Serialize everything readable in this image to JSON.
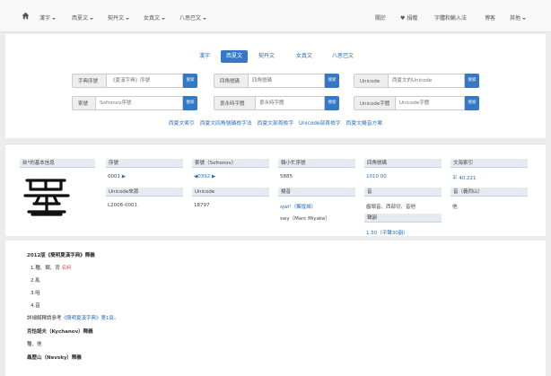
{
  "nav": {
    "left": [
      {
        "label": "漢字"
      },
      {
        "label": "西夏文"
      },
      {
        "label": "契丹文"
      },
      {
        "label": "女真文"
      },
      {
        "label": "八思巴文"
      }
    ],
    "right": {
      "about": "關於",
      "donate": "捐贈",
      "font_input": "字體和輸入法",
      "blog": "博客",
      "other": "其他"
    }
  },
  "script_tabs": [
    "漢字",
    "西夏文",
    "契丹文",
    "女真文",
    "八思巴文"
  ],
  "search": {
    "button_label": "搜索",
    "rows": [
      {
        "label": "字典序號",
        "placeholder": "《夏漢字典》序號"
      },
      {
        "label": "四角號碼",
        "placeholder": "四角號碼"
      },
      {
        "label": "Unicode",
        "placeholder": "西夏文的Unicode"
      },
      {
        "label": "索號",
        "placeholder": "Sofronov序號"
      },
      {
        "label": "景永時字體",
        "placeholder": "景永時字體"
      },
      {
        "label": "Unicode字體",
        "placeholder": "Unicode字體"
      }
    ],
    "links": [
      "西夏文索引",
      "西夏文四角號碼檢字法",
      "西夏文部首檢字",
      "Unicode部首檢字",
      "西夏文擬音方案"
    ]
  },
  "info": {
    "title": "𘈷*的基本信息",
    "headers": [
      "序號",
      "索號（Sofronov）",
      "韓小忙序號",
      "四角號碼",
      "文海索引",
      "Unicode來源",
      "Unicode",
      "擬音",
      "音",
      "音（義同山）",
      "聲韻"
    ],
    "values": {
      "seq": "0001",
      "sofronov": "0392",
      "han": "5885",
      "fourcorner": "1010 00",
      "wenhai": "平 40.221",
      "source": "L2008-0001",
      "unicode": "18797",
      "pron1": "sjwi¹（龔煌城）",
      "pron2": "swy（Marc Miyake）",
      "yin": "齒頭音、西部切、音他",
      "yin2": "他",
      "shengyun": "1.50（平聲30韻）"
    }
  },
  "notes": {
    "heading1": "2012版《簡明夏漢字典》釋義",
    "items": [
      "1.種、類、背",
      "2.亂",
      "3.咀",
      "4.音"
    ],
    "item1_red": "名詞",
    "ref_prefix": "詳細解釋請參考",
    "ref_link": "《簡明夏漢字典》第1頁。",
    "heading2": "克恰諾夫（Kychanov）釋義",
    "line2": "種、他",
    "heading3": "聶歷山（Nevsky）釋義"
  },
  "colors": {
    "accent": "#3478c6",
    "link": "#2a6ebb",
    "red": "#d9534f"
  }
}
